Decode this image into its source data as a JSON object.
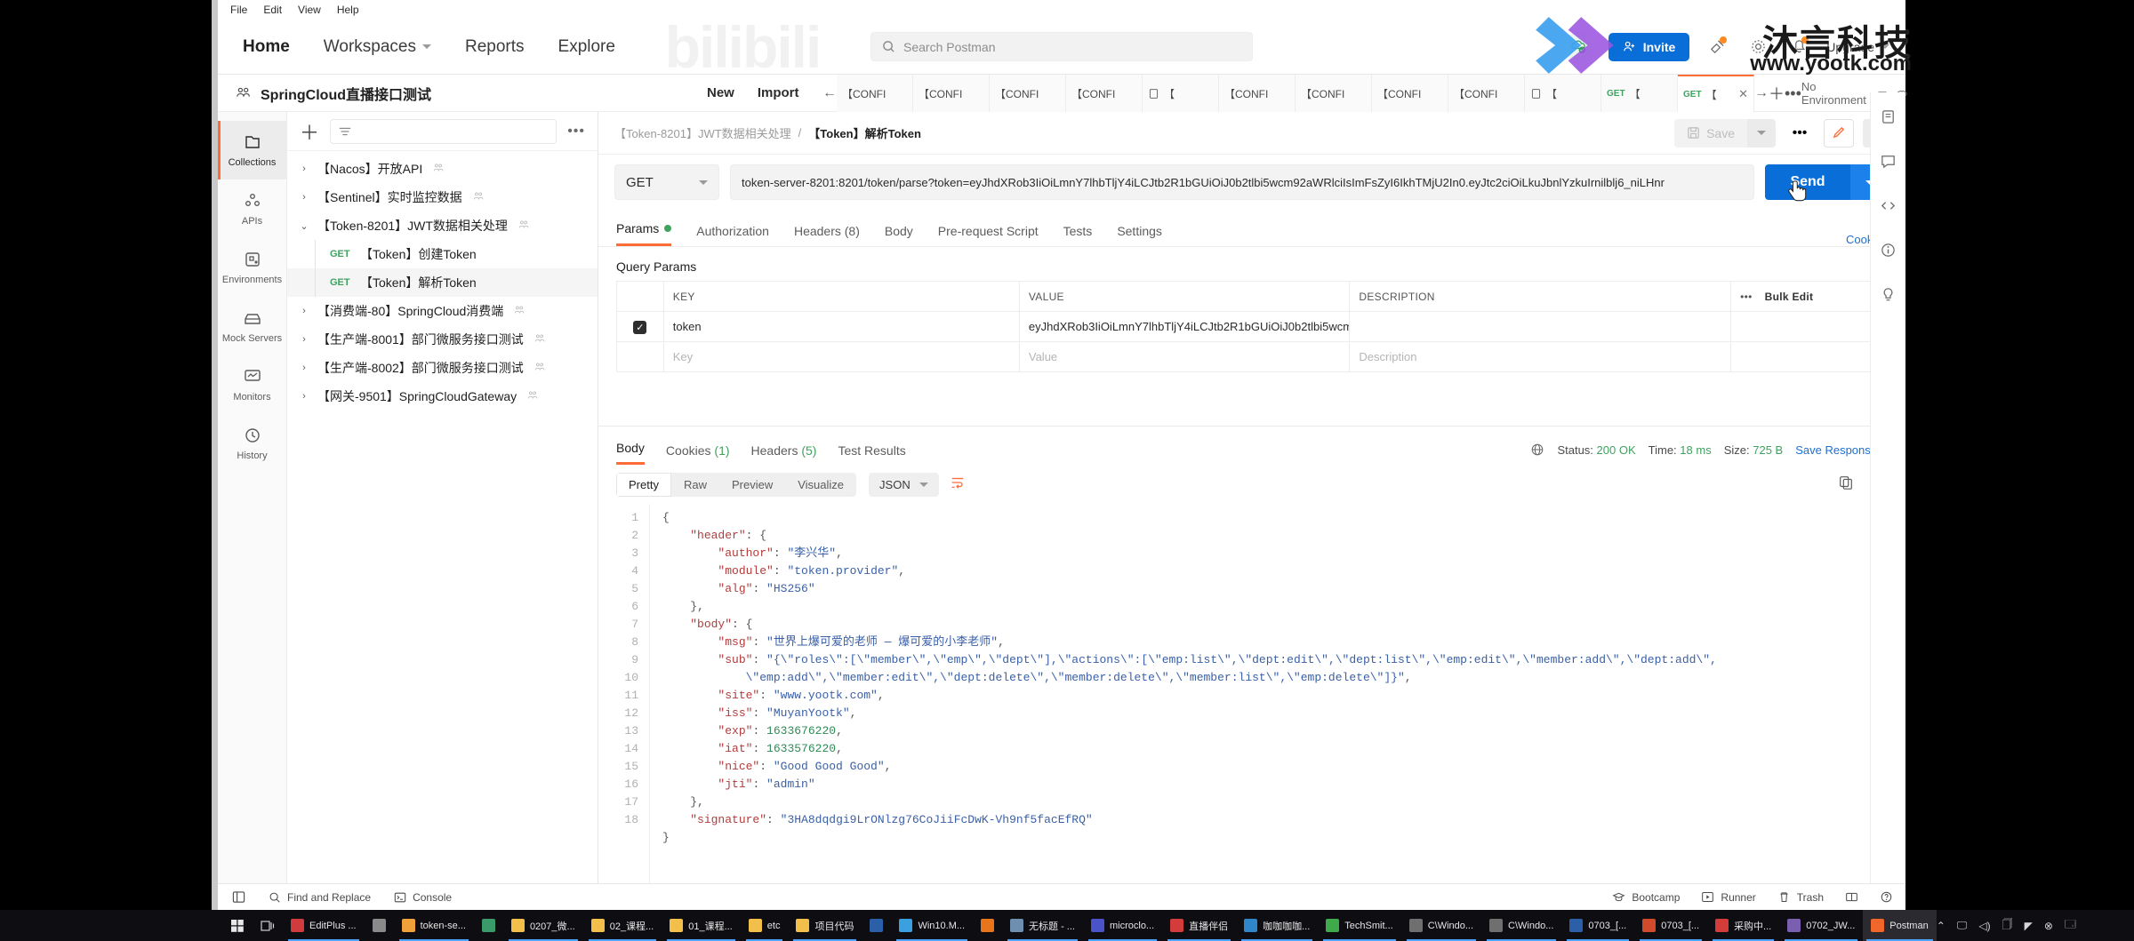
{
  "menubar": {
    "items": [
      "File",
      "Edit",
      "View",
      "Help"
    ]
  },
  "topnav": {
    "items": [
      {
        "label": "Home",
        "active": true,
        "caret": false
      },
      {
        "label": "Workspaces",
        "active": false,
        "caret": true
      },
      {
        "label": "Reports",
        "active": false,
        "caret": false
      },
      {
        "label": "Explore",
        "active": false,
        "caret": false
      }
    ],
    "search_placeholder": "Search Postman",
    "invite_label": "Invite",
    "upgrade_label": "Upgrade",
    "sync_icon": "cloud-check-icon",
    "notification_icon": "bell-icon",
    "settings_icon": "gear-icon",
    "invite_icon": "user-plus-icon"
  },
  "workspace": {
    "name": "SpringCloud直播接口测试",
    "team_icon": "team-icon",
    "new_label": "New",
    "import_label": "Import"
  },
  "tabstrip": {
    "back_icon": "arrow-left-icon",
    "forward_icon": "arrow-right-icon",
    "plus_icon": "plus-icon",
    "more_icon": "ellipsis-icon",
    "environment_label": "No Environment",
    "env_caret_icon": "chevron-down-icon",
    "eye_icon": "eye-icon",
    "tabs": [
      {
        "label": "【CONFI",
        "method": "",
        "icon": "",
        "active": false,
        "closable": false
      },
      {
        "label": "【CONFI",
        "method": "",
        "icon": "",
        "active": false,
        "closable": false
      },
      {
        "label": "【CONFI",
        "method": "",
        "icon": "",
        "active": false,
        "closable": false
      },
      {
        "label": "【CONFI",
        "method": "",
        "icon": "",
        "active": false,
        "closable": false
      },
      {
        "label": "【",
        "method": "",
        "icon": "doc-icon",
        "active": false,
        "closable": false
      },
      {
        "label": "【CONFI",
        "method": "",
        "icon": "",
        "active": false,
        "closable": false
      },
      {
        "label": "【CONFI",
        "method": "",
        "icon": "",
        "active": false,
        "closable": false
      },
      {
        "label": "【CONFI",
        "method": "",
        "icon": "",
        "active": false,
        "closable": false
      },
      {
        "label": "【CONFI",
        "method": "",
        "icon": "",
        "active": false,
        "closable": false
      },
      {
        "label": "【",
        "method": "",
        "icon": "doc-icon",
        "active": false,
        "closable": false
      },
      {
        "label": "【",
        "method": "GET",
        "icon": "",
        "active": false,
        "closable": false
      },
      {
        "label": "【",
        "method": "GET",
        "icon": "",
        "active": true,
        "closable": true
      }
    ]
  },
  "rail": {
    "items": [
      {
        "label": "Collections",
        "icon": "collections-icon",
        "active": true
      },
      {
        "label": "APIs",
        "icon": "apis-icon",
        "active": false
      },
      {
        "label": "Environments",
        "icon": "environments-icon",
        "active": false
      },
      {
        "label": "Mock Servers",
        "icon": "mock-servers-icon",
        "active": false
      },
      {
        "label": "Monitors",
        "icon": "monitors-icon",
        "active": false
      },
      {
        "label": "History",
        "icon": "history-icon",
        "active": false
      }
    ]
  },
  "sidebar": {
    "add_icon": "plus-icon",
    "filter_icon": "filter-icon",
    "more_icon": "ellipsis-icon",
    "rows": [
      {
        "label": "【Nacos】开放API",
        "chev": "›",
        "child": false,
        "method": "",
        "shared": true,
        "selected": false
      },
      {
        "label": "【Sentinel】实时监控数据",
        "chev": "›",
        "child": false,
        "method": "",
        "shared": true,
        "selected": false
      },
      {
        "label": "【Token-8201】JWT数据相关处理",
        "chev": "⌄",
        "child": false,
        "method": "",
        "shared": true,
        "selected": false
      },
      {
        "label": "【Token】创建Token",
        "chev": "",
        "child": true,
        "method": "GET",
        "shared": false,
        "selected": false
      },
      {
        "label": "【Token】解析Token",
        "chev": "",
        "child": true,
        "method": "GET",
        "shared": false,
        "selected": true
      },
      {
        "label": "【消费端-80】SpringCloud消费端",
        "chev": "›",
        "child": false,
        "method": "",
        "shared": true,
        "selected": false
      },
      {
        "label": "【生产端-8001】部门微服务接口测试",
        "chev": "›",
        "child": false,
        "method": "",
        "shared": true,
        "selected": false
      },
      {
        "label": "【生产端-8002】部门微服务接口测试",
        "chev": "›",
        "child": false,
        "method": "",
        "shared": true,
        "selected": false
      },
      {
        "label": "【网关-9501】SpringCloudGateway",
        "chev": "›",
        "child": false,
        "method": "",
        "shared": true,
        "selected": false
      }
    ]
  },
  "request": {
    "breadcrumb_parent": "【Token-8201】JWT数据相关处理",
    "breadcrumb_sep": "/",
    "breadcrumb_current": "【Token】解析Token",
    "save_label": "Save",
    "save_icon": "floppy-icon",
    "save_caret_icon": "chevron-down-icon",
    "more_icon": "ellipsis-icon",
    "edit_icon": "pencil-icon",
    "comment_icon": "comment-icon",
    "method": "GET",
    "method_caret_icon": "chevron-down-icon",
    "url": "token-server-8201:8201/token/parse?token=eyJhdXRob3IiOiLmnY7lhbTljY4iLCJtb2R1bGUiOiJ0b2tlbi5wcm92aWRlciIsImFsZyI6IkhTMjU2In0.eyJtc2ciOiLkuJbnlYzkuIrnilblj6_niLHnr",
    "send_label": "Send",
    "send_caret_icon": "chevron-down-icon",
    "cookies_link": "Cookies",
    "tabs": [
      {
        "label": "Params",
        "active": true,
        "dot": true
      },
      {
        "label": "Authorization",
        "active": false,
        "dot": false
      },
      {
        "label": "Headers (8)",
        "active": false,
        "dot": false
      },
      {
        "label": "Body",
        "active": false,
        "dot": false
      },
      {
        "label": "Pre-request Script",
        "active": false,
        "dot": false
      },
      {
        "label": "Tests",
        "active": false,
        "dot": false
      },
      {
        "label": "Settings",
        "active": false,
        "dot": false
      }
    ],
    "query_params_title": "Query Params",
    "table": {
      "headers": [
        "KEY",
        "VALUE",
        "DESCRIPTION"
      ],
      "bulk_edit_label": "Bulk Edit",
      "row_more_icon": "ellipsis-icon",
      "rows": [
        {
          "checked": true,
          "key": "token",
          "value": "eyJhdXRob3IiOiLmnY7lhbTljY4iLCJtb2R1bGUiOiJ0b2tlbi5wcm92aWRlci...",
          "description": "",
          "placeholder": false
        },
        {
          "checked": false,
          "key": "Key",
          "value": "Value",
          "description": "Description",
          "placeholder": true
        }
      ]
    }
  },
  "response": {
    "tabs": [
      {
        "label": "Body",
        "count": "",
        "active": true
      },
      {
        "label": "Cookies",
        "count": "(1)",
        "active": false
      },
      {
        "label": "Headers",
        "count": "(5)",
        "active": false
      },
      {
        "label": "Test Results",
        "count": "",
        "active": false
      }
    ],
    "globe_icon": "globe-icon",
    "status_label": "Status:",
    "status_value": "200 OK",
    "time_label": "Time:",
    "time_value": "18 ms",
    "size_label": "Size:",
    "size_value": "725 B",
    "save_response_label": "Save Response",
    "save_response_caret": "chevron-down-icon",
    "formats": [
      {
        "label": "Pretty",
        "active": true
      },
      {
        "label": "Raw",
        "active": false
      },
      {
        "label": "Preview",
        "active": false
      },
      {
        "label": "Visualize",
        "active": false
      }
    ],
    "content_type": "JSON",
    "content_type_caret": "chevron-down-icon",
    "wrap_icon": "wrap-lines-icon",
    "copy_icon": "copy-icon",
    "search_icon": "search-icon",
    "line_numbers": [
      1,
      2,
      3,
      4,
      5,
      6,
      7,
      8,
      9,
      10,
      11,
      12,
      13,
      14,
      15,
      16,
      17,
      18
    ],
    "json": {
      "header": {
        "author": "李兴华",
        "module": "token.provider",
        "alg": "HS256"
      },
      "body": {
        "msg": "世界上爆可爱的老师 — 爆可爱的小李老师",
        "sub": "{\"roles\":[\"member\",\"emp\",\"dept\"],\"actions\":[\"emp:list\",\"dept:edit\",\"dept:list\",\"emp:edit\",\"member:add\",\"dept:add\",\"emp:add\",\"member:edit\",\"dept:delete\",\"member:delete\",\"member:list\",\"emp:delete\"]}",
        "site": "www.yootk.com",
        "iss": "MuyanYootk",
        "exp": 1633676220,
        "iat": 1633576220,
        "nice": "Good Good Good",
        "jti": "admin"
      },
      "signature": "3HA8dqdgi9LrONlzg76CoJiiFcDwK-Vh9nf5facEfRQ"
    }
  },
  "statusbar": {
    "left": [
      {
        "label": "",
        "icon": "sidebar-toggle-icon"
      },
      {
        "label": "Find and Replace",
        "icon": "search-icon"
      },
      {
        "label": "Console",
        "icon": "console-icon"
      }
    ],
    "right": [
      {
        "label": "Bootcamp",
        "icon": "graduation-cap-icon"
      },
      {
        "label": "Runner",
        "icon": "play-box-icon"
      },
      {
        "label": "Trash",
        "icon": "trash-icon"
      },
      {
        "label": "",
        "icon": "layout-icon"
      },
      {
        "label": "",
        "icon": "help-icon"
      }
    ]
  },
  "taskbar": {
    "start_icon": "windows-icon",
    "taskview_icon": "task-view-icon",
    "items": [
      {
        "label": "EditPlus ...",
        "color": "#d03b3b",
        "open": true,
        "active": false
      },
      {
        "label": "",
        "color": "#8a8a8a",
        "open": false,
        "active": false
      },
      {
        "label": "token-se...",
        "color": "#f0a13a",
        "open": true,
        "active": false
      },
      {
        "label": "",
        "color": "#3a9a6a",
        "open": false,
        "active": false
      },
      {
        "label": "0207_微...",
        "color": "#f2c04a",
        "open": true,
        "active": false
      },
      {
        "label": "02_课程...",
        "color": "#f2c04a",
        "open": true,
        "active": false
      },
      {
        "label": "01_课程...",
        "color": "#f2c04a",
        "open": true,
        "active": false
      },
      {
        "label": "etc",
        "color": "#f2c04a",
        "open": true,
        "active": false
      },
      {
        "label": "项目代码",
        "color": "#f2c04a",
        "open": true,
        "active": false
      },
      {
        "label": "",
        "color": "#2b5fa8",
        "open": false,
        "active": false
      },
      {
        "label": "Win10.M...",
        "color": "#3aa0e0",
        "open": true,
        "active": false
      },
      {
        "label": "",
        "color": "#e8741c",
        "open": false,
        "active": false
      },
      {
        "label": "无标题 - ...",
        "color": "#6f8fb0",
        "open": true,
        "active": false
      },
      {
        "label": "microclo...",
        "color": "#4a53c7",
        "open": true,
        "active": false
      },
      {
        "label": "直播伴侣",
        "color": "#d43c3c",
        "open": true,
        "active": false
      },
      {
        "label": "咖咖咖咖...",
        "color": "#2f86c9",
        "open": true,
        "active": false
      },
      {
        "label": "TechSmit...",
        "color": "#3faa4a",
        "open": true,
        "active": false
      },
      {
        "label": "C\\Windo...",
        "color": "#6f6f6f",
        "open": true,
        "active": false
      },
      {
        "label": "C\\Windo...",
        "color": "#6f6f6f",
        "open": true,
        "active": false
      },
      {
        "label": "0703_[...",
        "color": "#2b5fa8",
        "open": true,
        "active": false
      },
      {
        "label": "0703_[...",
        "color": "#d04a2b",
        "open": true,
        "active": false
      },
      {
        "label": "采购中...",
        "color": "#d43c3c",
        "open": true,
        "active": false
      },
      {
        "label": "0702_JW...",
        "color": "#7a5fb0",
        "open": true,
        "active": false
      },
      {
        "label": "Postman",
        "color": "#f0662b",
        "open": true,
        "active": true
      }
    ],
    "tray": [
      "⌃",
      "🖵",
      "◁)",
      "🗍",
      "◤",
      "⊗",
      "🗔"
    ]
  },
  "watermarks": {
    "bilibili": "bilibili",
    "brand_cn": "沐言科技",
    "brand_url": "www.yootk.com"
  }
}
